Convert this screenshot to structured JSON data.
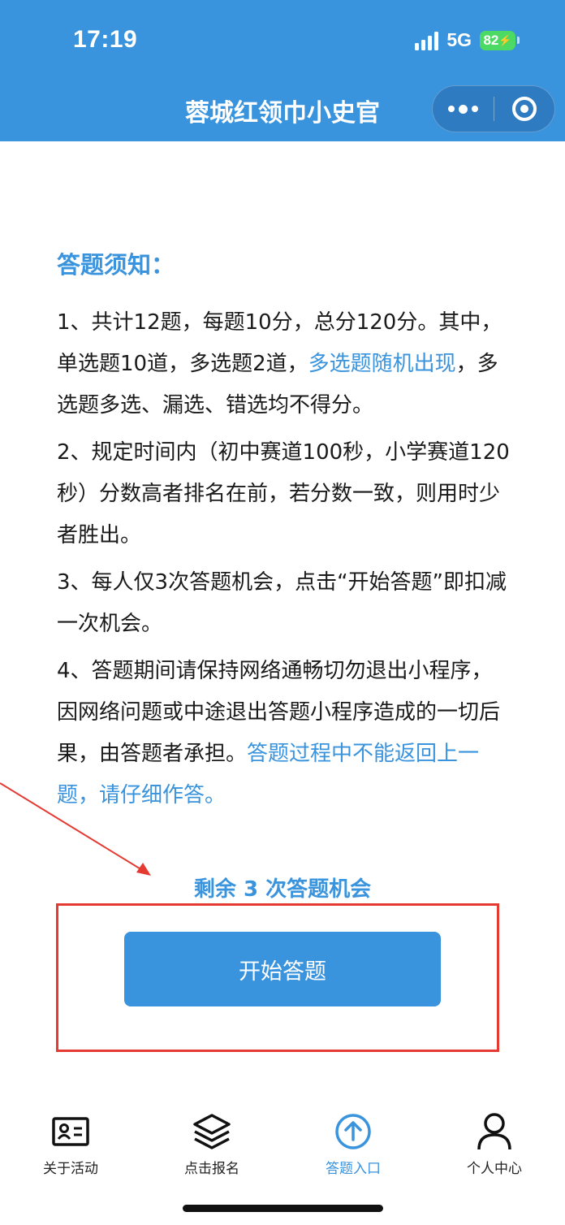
{
  "status_bar": {
    "time": "17:19",
    "network": "5G",
    "battery": "82"
  },
  "nav": {
    "title": "蓉城红领巾小史官"
  },
  "notice": {
    "title": "答题须知：",
    "rules": [
      {
        "normal": "1、共计12题，每题10分，总分120分。其中，单选题10道，多选题2道，",
        "highlight": "多选题随机出现",
        "after": "，多选题多选、漏选、错选均不得分。"
      },
      {
        "normal": "2、规定时间内（初中赛道100秒，小学赛道120秒）分数高者排名在前，若分数一致，则用时少者胜出。",
        "highlight": "",
        "after": ""
      },
      {
        "normal": "3、每人仅3次答题机会，点击“开始答题”即扣减一次机会。",
        "highlight": "",
        "after": ""
      },
      {
        "normal": "4、答题期间请保持网络通畅切勿退出小程序，因网络问题或中途退出答题小程序造成的一切后果，由答题者承担。",
        "highlight": "答题过程中不能返回上一题，请仔细作答。",
        "after": ""
      }
    ]
  },
  "remaining_text": "剩余 3 次答题机会",
  "start_button": "开始答题",
  "tabbar": {
    "items": [
      {
        "label": "关于活动",
        "icon": "id-card-icon"
      },
      {
        "label": "点击报名",
        "icon": "layers-icon"
      },
      {
        "label": "答题入口",
        "icon": "upload-circle-icon"
      },
      {
        "label": "个人中心",
        "icon": "person-icon"
      }
    ],
    "active_index": 2
  },
  "colors": {
    "primary": "#3a93dd",
    "annotation_red": "#e53a32"
  }
}
